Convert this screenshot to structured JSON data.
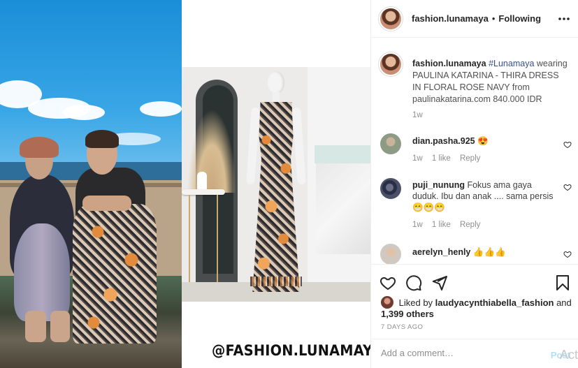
{
  "header": {
    "username": "fashion.lunamaya",
    "separator": "•",
    "follow_status": "Following"
  },
  "caption": {
    "username": "fashion.lunamaya",
    "hashtag": "#Lunamaya",
    "text": "wearing PAULINA KATARINA - THIRA DRESS IN FLORAL ROSE NAVY from paulinakatarina.com 840.000 IDR",
    "time": "1w"
  },
  "comments": [
    {
      "username": "dian.pasha.925",
      "text": "😍",
      "time": "1w",
      "likes": "1 like",
      "reply": "Reply"
    },
    {
      "username": "puji_nunung",
      "text": "Fokus ama gaya duduk. Ibu dan anak .... sama persis 😁😁😁",
      "time": "1w",
      "likes": "1 like",
      "reply": "Reply"
    },
    {
      "username": "aerelyn_henly",
      "text": "👍👍👍"
    }
  ],
  "likes": {
    "prefix": "Liked by",
    "user": "laudyacynthiabella_fashion",
    "middle": "and",
    "others": "1,399 others"
  },
  "posted_ago": "7 DAYS AGO",
  "add_comment": {
    "placeholder": "Add a comment…",
    "post_label": "Post"
  },
  "watermark": "@FASHION.LUNAMAYA",
  "overlay_text": "Act",
  "icons": {
    "more": "more-icon",
    "like": "heart-icon",
    "comment": "comment-icon",
    "share": "share-icon",
    "save": "bookmark-icon"
  }
}
